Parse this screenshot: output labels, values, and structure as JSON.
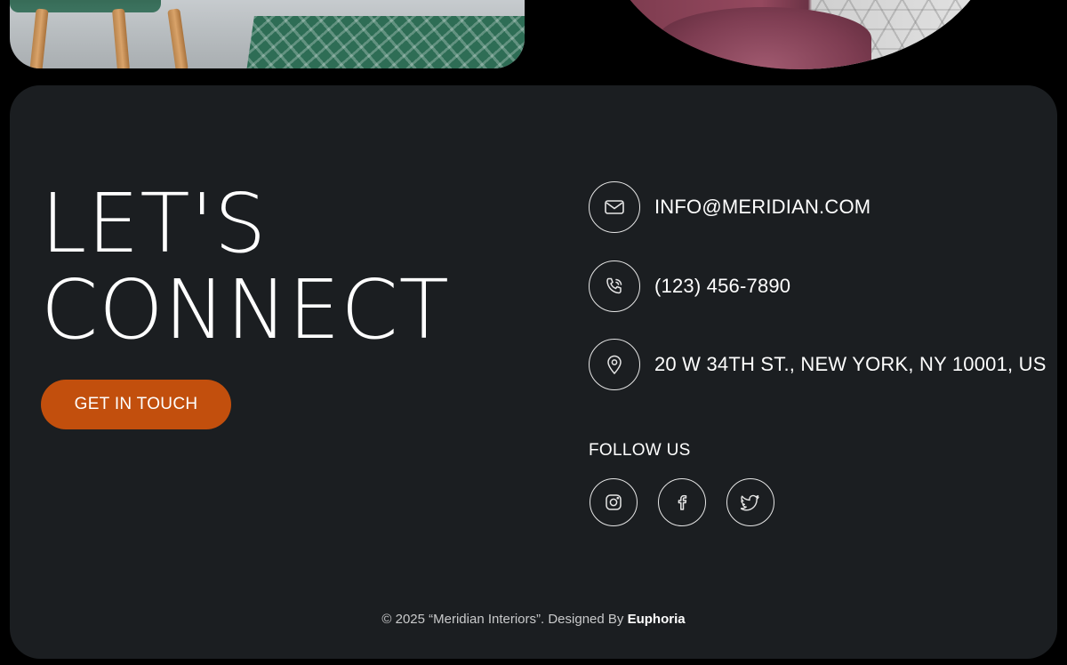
{
  "headline": {
    "line1": "LET'S",
    "line2": "CONNECT"
  },
  "cta": {
    "label": "GET IN TOUCH",
    "color": "#c24f0d"
  },
  "contact": {
    "email": {
      "icon": "mail-icon",
      "text": "INFO@MERIDIAN.COM"
    },
    "phone": {
      "icon": "phone-icon",
      "text": "(123) 456-7890"
    },
    "address": {
      "icon": "location-pin-icon",
      "text": "20 W 34TH ST., NEW YORK, NY 10001, US"
    }
  },
  "follow": {
    "title": "FOLLOW US",
    "socials": [
      {
        "icon": "instagram-icon"
      },
      {
        "icon": "facebook-icon"
      },
      {
        "icon": "twitter-icon"
      }
    ]
  },
  "footer": {
    "copyright_prefix": "© 2025  “Meridian Interiors”. Designed By",
    "designer": "Euphoria"
  },
  "colors": {
    "panel_bg": "#1b1e21",
    "page_bg": "#000000",
    "accent": "#c24f0d"
  }
}
